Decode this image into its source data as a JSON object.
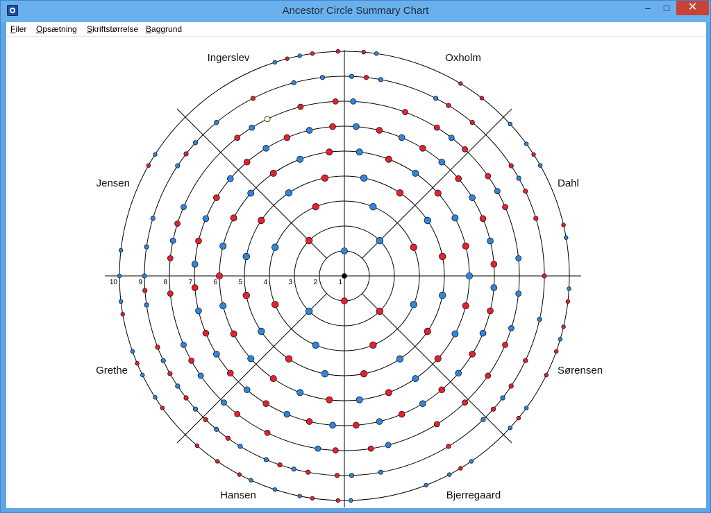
{
  "window": {
    "title": "Ancestor Circle Summary Chart",
    "minimize_glyph": "–",
    "maximize_glyph": "□",
    "close_glyph": "✕"
  },
  "menu": [
    {
      "first": "F",
      "rest": "iler"
    },
    {
      "first": "O",
      "rest": "psætning"
    },
    {
      "first": "S",
      "rest": "kriftstørrelse"
    },
    {
      "first": "B",
      "rest": "aggrund"
    }
  ],
  "chart_data": {
    "type": "radial",
    "generation_rings": [
      "1",
      "2",
      "3",
      "4",
      "5",
      "6",
      "7",
      "8",
      "9",
      "10"
    ],
    "sector_labels": [
      "Oxholm",
      "Dahl",
      "Sørensen",
      "Bjerregaard",
      "Hansen",
      "Grethe",
      "Jensen",
      "Ingerslev"
    ],
    "colors": {
      "male": "#2e86de",
      "female": "#e8202a",
      "unknown": "#fbfbd0",
      "root": "#000000"
    }
  }
}
